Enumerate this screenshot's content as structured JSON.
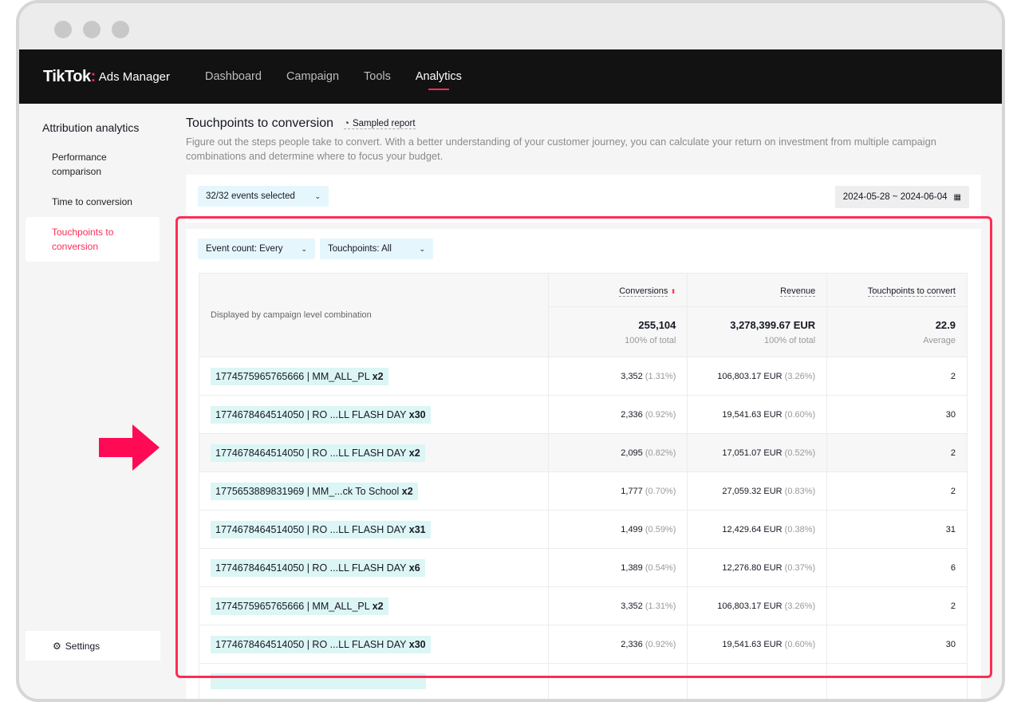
{
  "header": {
    "logo": "TikTok",
    "logo_sub": "Ads Manager",
    "nav": [
      "Dashboard",
      "Campaign",
      "Tools",
      "Analytics"
    ],
    "active": "Analytics"
  },
  "sidebar": {
    "title": "Attribution analytics",
    "items": [
      "Performance comparison",
      "Time to conversion",
      "Touchpoints to conversion"
    ],
    "settings": "Settings"
  },
  "page": {
    "title": "Touchpoints to conversion",
    "sampled": "Sampled report",
    "description": "Figure out the steps people take to convert. With a better understanding of your customer journey, you can calculate your return on investment from multiple campaign combinations and determine where to focus your budget."
  },
  "filters": {
    "events": "32/32 events selected",
    "date_range": "2024-05-28 ~ 2024-06-04",
    "event_count_label": "Event count:",
    "event_count_value": "Every",
    "touchpoints_label": "Touchpoints:",
    "touchpoints_value": "All"
  },
  "table": {
    "group_label": "Displayed by campaign level combination",
    "columns": [
      "Conversions",
      "Revenue",
      "Touchpoints to convert"
    ],
    "totals": {
      "conversions": "255,104",
      "conversions_sub": "100% of total",
      "revenue": "3,278,399.67 EUR",
      "revenue_sub": "100% of total",
      "touchpoints": "22.9",
      "touchpoints_sub": "Average"
    },
    "rows": [
      {
        "name": "1774575965765666 | MM_ALL_PL",
        "mult": "x2",
        "conv": "3,352",
        "conv_pct": "(1.31%)",
        "rev": "106,803.17 EUR",
        "rev_pct": "(3.26%)",
        "tp": "2"
      },
      {
        "name": "1774678464514050 | RO ...LL FLASH DAY",
        "mult": "x30",
        "conv": "2,336",
        "conv_pct": "(0.92%)",
        "rev": "19,541.63 EUR",
        "rev_pct": "(0.60%)",
        "tp": "30"
      },
      {
        "name": "1774678464514050 | RO ...LL FLASH DAY",
        "mult": "x2",
        "conv": "2,095",
        "conv_pct": "(0.82%)",
        "rev": "17,051.07 EUR",
        "rev_pct": "(0.52%)",
        "tp": "2"
      },
      {
        "name": "1775653889831969 | MM_...ck To School",
        "mult": "x2",
        "conv": "1,777",
        "conv_pct": "(0.70%)",
        "rev": "27,059.32 EUR",
        "rev_pct": "(0.83%)",
        "tp": "2"
      },
      {
        "name": "1774678464514050 | RO ...LL FLASH DAY",
        "mult": "x31",
        "conv": "1,499",
        "conv_pct": "(0.59%)",
        "rev": "12,429.64 EUR",
        "rev_pct": "(0.38%)",
        "tp": "31"
      },
      {
        "name": "1774678464514050 | RO ...LL FLASH DAY",
        "mult": "x6",
        "conv": "1,389",
        "conv_pct": "(0.54%)",
        "rev": "12,276.80 EUR",
        "rev_pct": "(0.37%)",
        "tp": "6"
      },
      {
        "name": "1774575965765666 | MM_ALL_PL",
        "mult": "x2",
        "conv": "3,352",
        "conv_pct": "(1.31%)",
        "rev": "106,803.17 EUR",
        "rev_pct": "(3.26%)",
        "tp": "2"
      },
      {
        "name": "1774678464514050 | RO ...LL FLASH DAY",
        "mult": "x30",
        "conv": "2,336",
        "conv_pct": "(0.92%)",
        "rev": "19,541.63 EUR",
        "rev_pct": "(0.60%)",
        "tp": "30"
      }
    ]
  },
  "colors": {
    "accent": "#fe2c55",
    "chip": "#dcf5f5",
    "select": "#e6f6fd"
  }
}
